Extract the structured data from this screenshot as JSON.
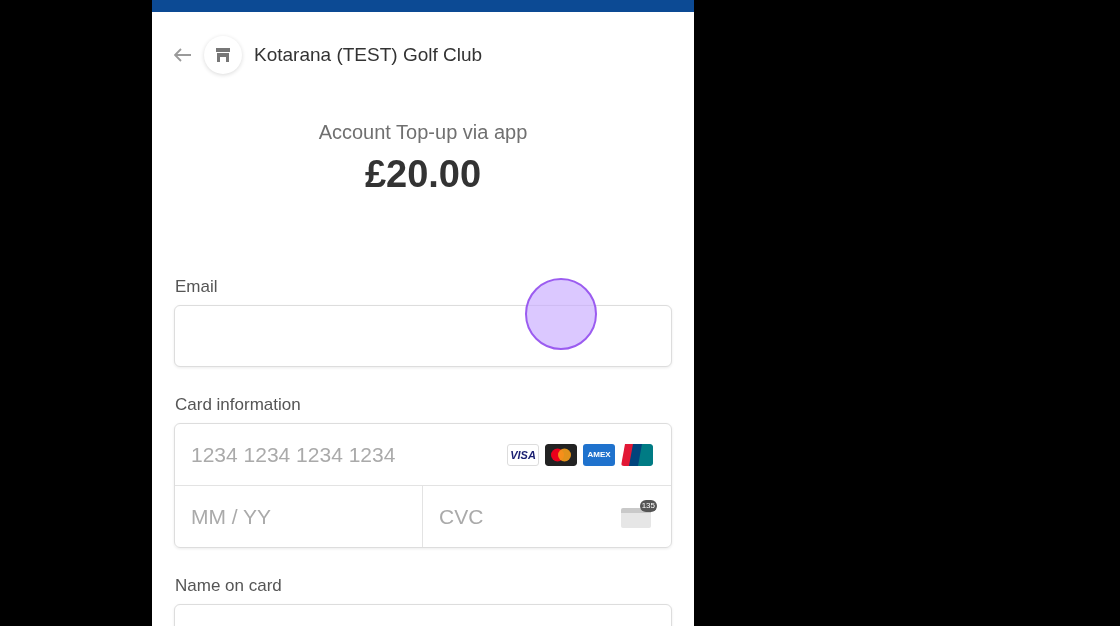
{
  "header": {
    "merchant": "Kotarana (TEST) Golf Club"
  },
  "summary": {
    "title": "Account Top-up via app",
    "amount": "£20.00"
  },
  "email": {
    "label": "Email"
  },
  "card": {
    "label": "Card information",
    "number_placeholder": "1234 1234 1234 1234",
    "expiry_placeholder": "MM / YY",
    "cvc_placeholder": "CVC",
    "cvc_hint": "135",
    "brands": [
      {
        "kind": "visa",
        "text": "VISA"
      },
      {
        "kind": "mastercard"
      },
      {
        "kind": "amex",
        "text": "AMEX"
      },
      {
        "kind": "unionpay"
      }
    ]
  },
  "name_on_card": {
    "label": "Name on card"
  },
  "touch_indicator": {
    "visible": true
  }
}
